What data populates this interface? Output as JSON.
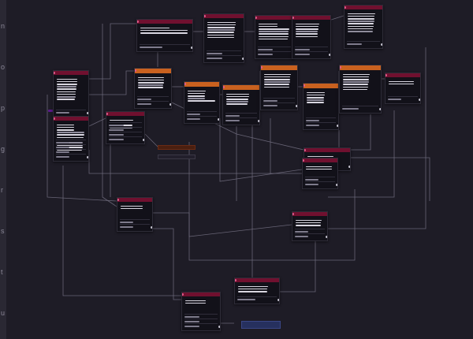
{
  "canvas": {
    "background": "#1e1c26",
    "header_color_maroon": "#6b1030",
    "header_color_orange": "#c9611f",
    "wire_color": "#6f6b7d"
  },
  "edge": {
    "glyphs": [
      "n",
      "o",
      "p",
      "g",
      "r",
      "s",
      "t",
      "u"
    ]
  },
  "nodes": [
    {
      "id": "n1",
      "style": "maroon",
      "lines": 3,
      "footer_rows": 1
    },
    {
      "id": "n2",
      "style": "maroon",
      "lines": 9,
      "footer_rows": 1
    },
    {
      "id": "n3",
      "style": "maroon",
      "lines": 7,
      "footer_rows": 2
    },
    {
      "id": "n4",
      "style": "maroon",
      "lines": 7,
      "footer_rows": 2
    },
    {
      "id": "n5",
      "style": "maroon",
      "lines": 6,
      "footer_rows": 2
    },
    {
      "id": "n6",
      "style": "maroon",
      "lines": 8,
      "footer_rows": 1
    },
    {
      "id": "n7",
      "style": "maroon",
      "lines": 11,
      "footer_rows": 4
    },
    {
      "id": "n8",
      "style": "maroon",
      "lines": 4,
      "footer_rows": 4
    },
    {
      "id": "n9",
      "style": "orange",
      "lines": 5,
      "footer_rows": 2
    },
    {
      "id": "n10",
      "style": "orange",
      "lines": 5,
      "footer_rows": 2
    },
    {
      "id": "n11",
      "style": "orange",
      "lines": 5,
      "footer_rows": 2
    },
    {
      "id": "n12",
      "style": "orange",
      "lines": 6,
      "footer_rows": 2
    },
    {
      "id": "n13",
      "style": "orange",
      "lines": 5,
      "footer_rows": 2
    },
    {
      "id": "n14",
      "style": "orange",
      "lines": 7,
      "footer_rows": 1
    },
    {
      "id": "n15",
      "style": "maroon",
      "lines": 2,
      "footer_rows": 1
    },
    {
      "id": "n16",
      "style": "maroon",
      "lines": 3,
      "footer_rows": 0
    },
    {
      "id": "n17",
      "style": "maroon",
      "lines": 2,
      "footer_rows": 2
    },
    {
      "id": "n18",
      "style": "maroon",
      "lines": 3,
      "footer_rows": 2
    },
    {
      "id": "n19",
      "style": "maroon",
      "lines": 2,
      "footer_rows": 3
    },
    {
      "id": "n20",
      "style": "maroon",
      "lines": 3,
      "footer_rows": 1
    },
    {
      "id": "n21",
      "style": "maroon",
      "lines": 2,
      "footer_rows": 2
    }
  ],
  "mini_nodes": [
    {
      "id": "m1",
      "style": "brown"
    },
    {
      "id": "m2",
      "style": "dark"
    },
    {
      "id": "m3",
      "style": "blue"
    }
  ]
}
